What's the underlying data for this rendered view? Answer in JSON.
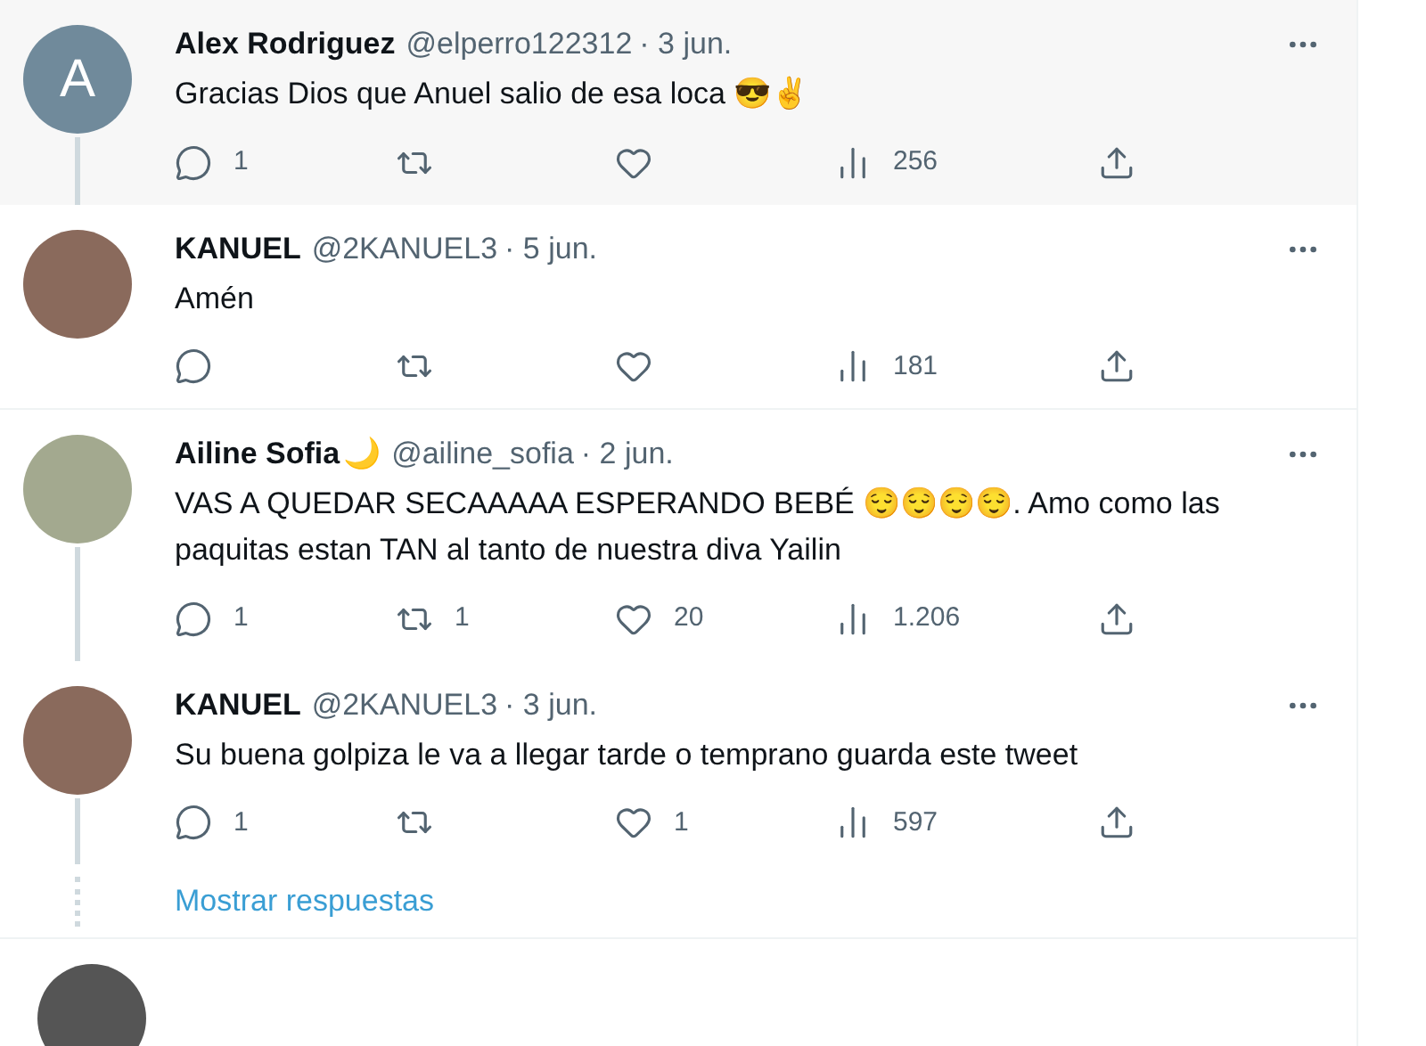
{
  "tweets": [
    {
      "avatar": {
        "kind": "letter",
        "letter": "A",
        "color": "#708a9b"
      },
      "name": "Alex Rodriguez",
      "handle": "@elperro122312",
      "date": "· 3 jun.",
      "text": "Gracias Dios que Anuel salio de esa loca 😎✌️",
      "highlighted": true,
      "thread_line": true,
      "stats": {
        "replies": "1",
        "views": "256"
      }
    },
    {
      "avatar": {
        "kind": "photo"
      },
      "name": "KANUEL",
      "handle": "@2KANUEL3",
      "date": "· 5 jun.",
      "text": "Amén",
      "highlighted": false,
      "thread_line": false,
      "stats": {
        "views": "181"
      }
    },
    {
      "avatar": {
        "kind": "plain",
        "color": "#a3a98f"
      },
      "name": "Ailine Sofia",
      "name_emoji": "🌙",
      "handle": "@ailine_sofia",
      "date": "· 2 jun.",
      "text": "VAS A QUEDAR SECAAAAA ESPERANDO BEBÉ 😌😌😌😌. Amo como las paquitas estan TAN al tanto de nuestra diva Yailin",
      "highlighted": false,
      "thread_line": true,
      "stats": {
        "replies": "1",
        "reposts": "1",
        "likes": "20",
        "views": "1.206"
      }
    },
    {
      "avatar": {
        "kind": "photo"
      },
      "name": "KANUEL",
      "handle": "@2KANUEL3",
      "date": "· 3 jun.",
      "text": "Su buena golpiza le va a llegar tarde o temprano guarda este tweet",
      "highlighted": false,
      "thread_line": true,
      "stats": {
        "replies": "1",
        "likes": "1",
        "views": "597"
      }
    }
  ],
  "show_replies": "Mostrar respuestas"
}
